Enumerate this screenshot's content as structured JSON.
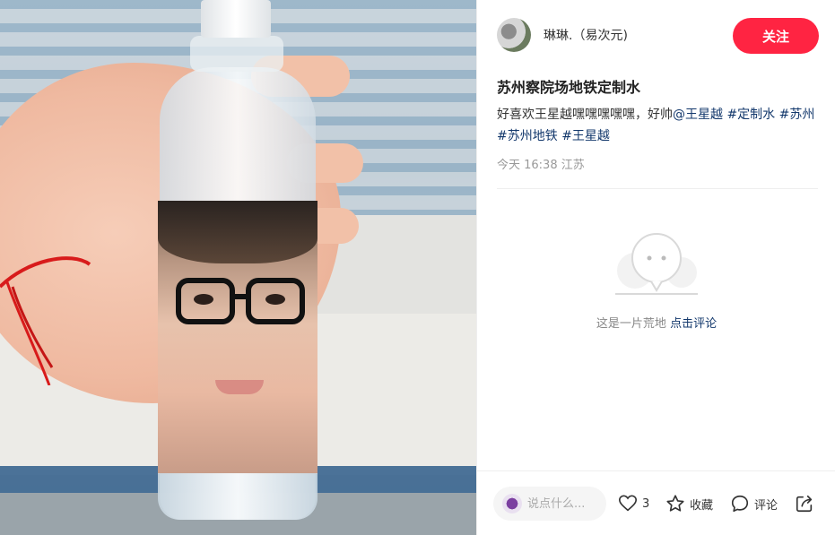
{
  "author": {
    "name": "琳琳.（易次元)"
  },
  "follow_button": {
    "label": "关注"
  },
  "note": {
    "title": "苏州察院场地铁定制水",
    "desc_text": "好喜欢王星越嘿嘿嘿嘿嘿，好帅",
    "mention": "@王星越",
    "tags": [
      "#定制水",
      "#苏州",
      "#苏州地铁",
      "#王星越"
    ],
    "meta": "今天 16:38 江苏"
  },
  "comments": {
    "empty_text": "这是一片荒地",
    "empty_link": "点击评论"
  },
  "footer": {
    "comment_placeholder": "说点什么...",
    "like_count": "3",
    "favorite_label": "收藏",
    "comment_label": "评论"
  },
  "colors": {
    "accent": "#ff2442",
    "tag": "#13386c"
  },
  "icons": [
    "heart-icon",
    "star-icon",
    "comment-icon",
    "share-icon"
  ]
}
